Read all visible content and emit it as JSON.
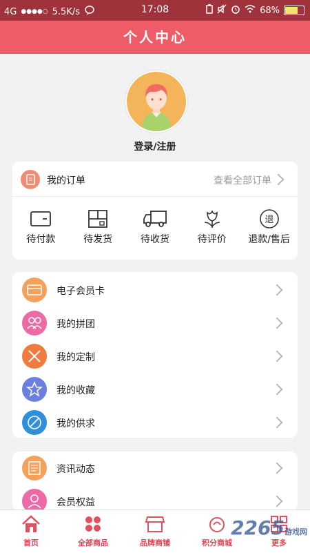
{
  "status_bar": {
    "network": "4G",
    "signal": "●●●●○",
    "speed": "5.5K/s",
    "time": "17:08",
    "battery_percent": "68%",
    "battery_level": 0.68
  },
  "header": {
    "title": "个人中心"
  },
  "profile": {
    "login_label": "登录/注册"
  },
  "orders": {
    "title": "我的订单",
    "view_all": "查看全部订单",
    "items": [
      {
        "label": "待付款",
        "icon": "wallet-icon"
      },
      {
        "label": "待发货",
        "icon": "package-icon"
      },
      {
        "label": "待收货",
        "icon": "truck-icon"
      },
      {
        "label": "待评价",
        "icon": "flower-icon"
      },
      {
        "label": "退款/售后",
        "icon": "refund-icon",
        "glyph": "退"
      }
    ]
  },
  "menu1": [
    {
      "label": "电子会员卡",
      "icon": "member-card-icon",
      "color": "#f6a15b"
    },
    {
      "label": "我的拼团",
      "icon": "group-icon",
      "color": "#ee6aa7"
    },
    {
      "label": "我的定制",
      "icon": "customize-icon",
      "color": "#f07b3f"
    },
    {
      "label": "我的收藏",
      "icon": "star-icon",
      "color": "#6a7fe0"
    },
    {
      "label": "我的供求",
      "icon": "supply-icon",
      "color": "#2f8fd8"
    }
  ],
  "menu2": [
    {
      "label": "资讯动态",
      "icon": "news-icon",
      "color": "#f6a15b"
    },
    {
      "label": "会员权益",
      "icon": "rights-icon",
      "color": "#ee6aa7"
    }
  ],
  "tabbar": [
    {
      "label": "首页",
      "icon": "home-icon"
    },
    {
      "label": "全部商品",
      "icon": "grid-icon"
    },
    {
      "label": "品牌商铺",
      "icon": "shop-icon"
    },
    {
      "label": "积分商城",
      "icon": "points-icon"
    },
    {
      "label": "更多",
      "icon": "more-icon"
    }
  ],
  "watermark": {
    "text": "2265",
    "sub": "游戏网"
  },
  "colors": {
    "header": "#ef5b67",
    "statusbar": "#a0323c",
    "tab_text": "#d94a55"
  }
}
